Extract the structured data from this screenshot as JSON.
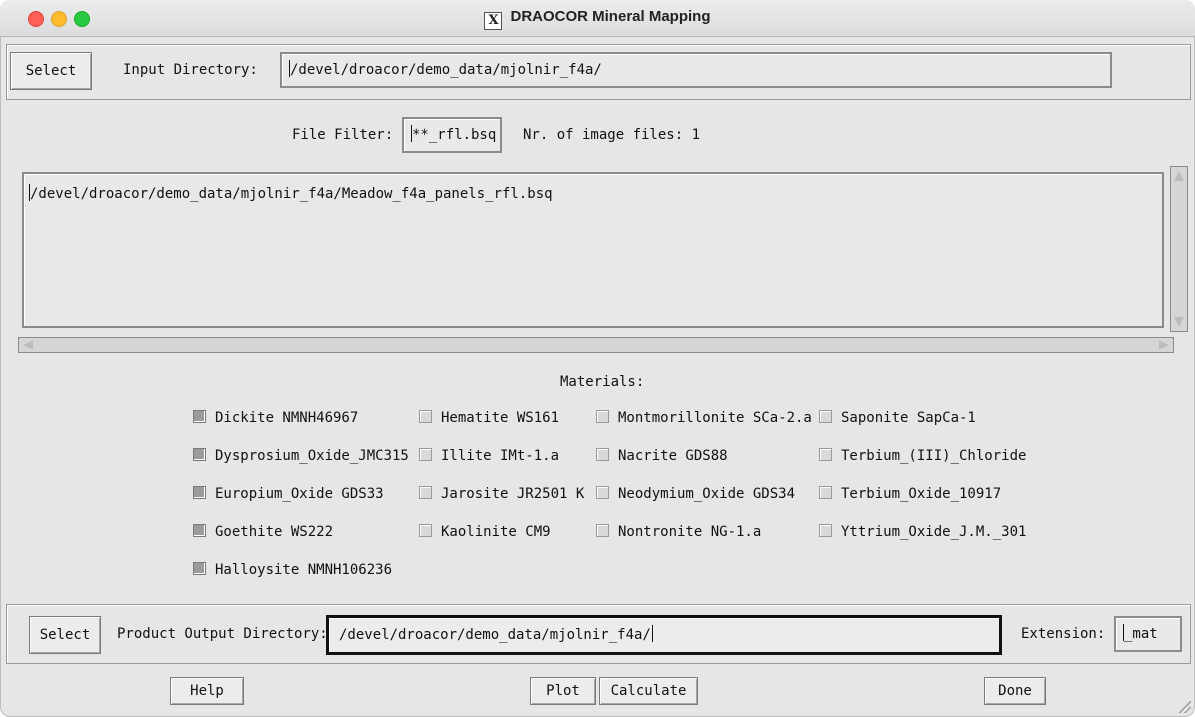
{
  "window": {
    "title": "DRAOCOR Mineral Mapping"
  },
  "input": {
    "select_label": "Select",
    "dir_label": "Input Directory:",
    "dir_value": "/devel/droacor/demo_data/mjolnir_f4a/"
  },
  "filter": {
    "label": "File Filter:",
    "value": "**_rfl.bsq",
    "count_label": "Nr. of image files: 1"
  },
  "file_list": [
    "/devel/droacor/demo_data/mjolnir_f4a/Meadow_f4a_panels_rfl.bsq"
  ],
  "materials": {
    "heading": "Materials:",
    "columns": [
      [
        {
          "label": "Dickite NMNH46967",
          "checked": true
        },
        {
          "label": "Dysprosium_Oxide_JMC315",
          "checked": true
        },
        {
          "label": "Europium_Oxide GDS33",
          "checked": true
        },
        {
          "label": "Goethite WS222",
          "checked": true
        },
        {
          "label": "Halloysite NMNH106236",
          "checked": true
        }
      ],
      [
        {
          "label": "Hematite WS161",
          "checked": false
        },
        {
          "label": "Illite IMt-1.a",
          "checked": false
        },
        {
          "label": "Jarosite JR2501 K",
          "checked": false
        },
        {
          "label": "Kaolinite CM9",
          "checked": false
        }
      ],
      [
        {
          "label": "Montmorillonite SCa-2.a",
          "checked": false
        },
        {
          "label": "Nacrite GDS88",
          "checked": false
        },
        {
          "label": "Neodymium_Oxide GDS34",
          "checked": false
        },
        {
          "label": "Nontronite NG-1.a",
          "checked": false
        }
      ],
      [
        {
          "label": "Saponite SapCa-1",
          "checked": false
        },
        {
          "label": "Terbium_(III)_Chloride",
          "checked": false
        },
        {
          "label": "Terbium_Oxide_10917",
          "checked": false
        },
        {
          "label": "Yttrium_Oxide_J.M._301",
          "checked": false
        }
      ]
    ]
  },
  "output": {
    "select_label": "Select",
    "dir_label": "Product Output Directory:",
    "dir_value": "/devel/droacor/demo_data/mjolnir_f4a/",
    "ext_label": "Extension:",
    "ext_value": "_mat"
  },
  "footer": {
    "help": "Help",
    "plot": "Plot",
    "calculate": "Calculate",
    "done": "Done"
  }
}
